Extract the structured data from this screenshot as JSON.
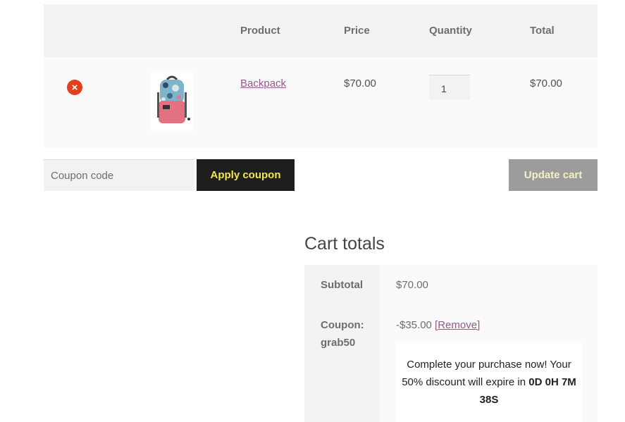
{
  "cart": {
    "headers": {
      "product": "Product",
      "price": "Price",
      "quantity": "Quantity",
      "total": "Total"
    },
    "items": [
      {
        "name": "Backpack",
        "price": "$70.00",
        "quantity": "1",
        "total": "$70.00",
        "image": "backpack-image",
        "remove_icon": "remove-circle-x-icon"
      }
    ]
  },
  "actions": {
    "coupon_placeholder": "Coupon code",
    "apply_label": "Apply coupon",
    "update_label": "Update cart"
  },
  "totals": {
    "title": "Cart totals",
    "subtotal_label": "Subtotal",
    "subtotal_value": "$70.00",
    "coupon_label_1": "Coupon:",
    "coupon_label_2": "grab50",
    "coupon_value": "-$35.00",
    "coupon_remove": "[Remove]",
    "promo_text_1": "Complete your purchase now! Your 50% discount will expire in",
    "promo_timer": "0D 0H 7M 38S"
  },
  "colors": {
    "remove": "#e2401c",
    "link": "#96588a",
    "apply_bg": "#1e1e1e",
    "apply_text": "#f2e84a",
    "update_bg": "#9c9c9c"
  }
}
